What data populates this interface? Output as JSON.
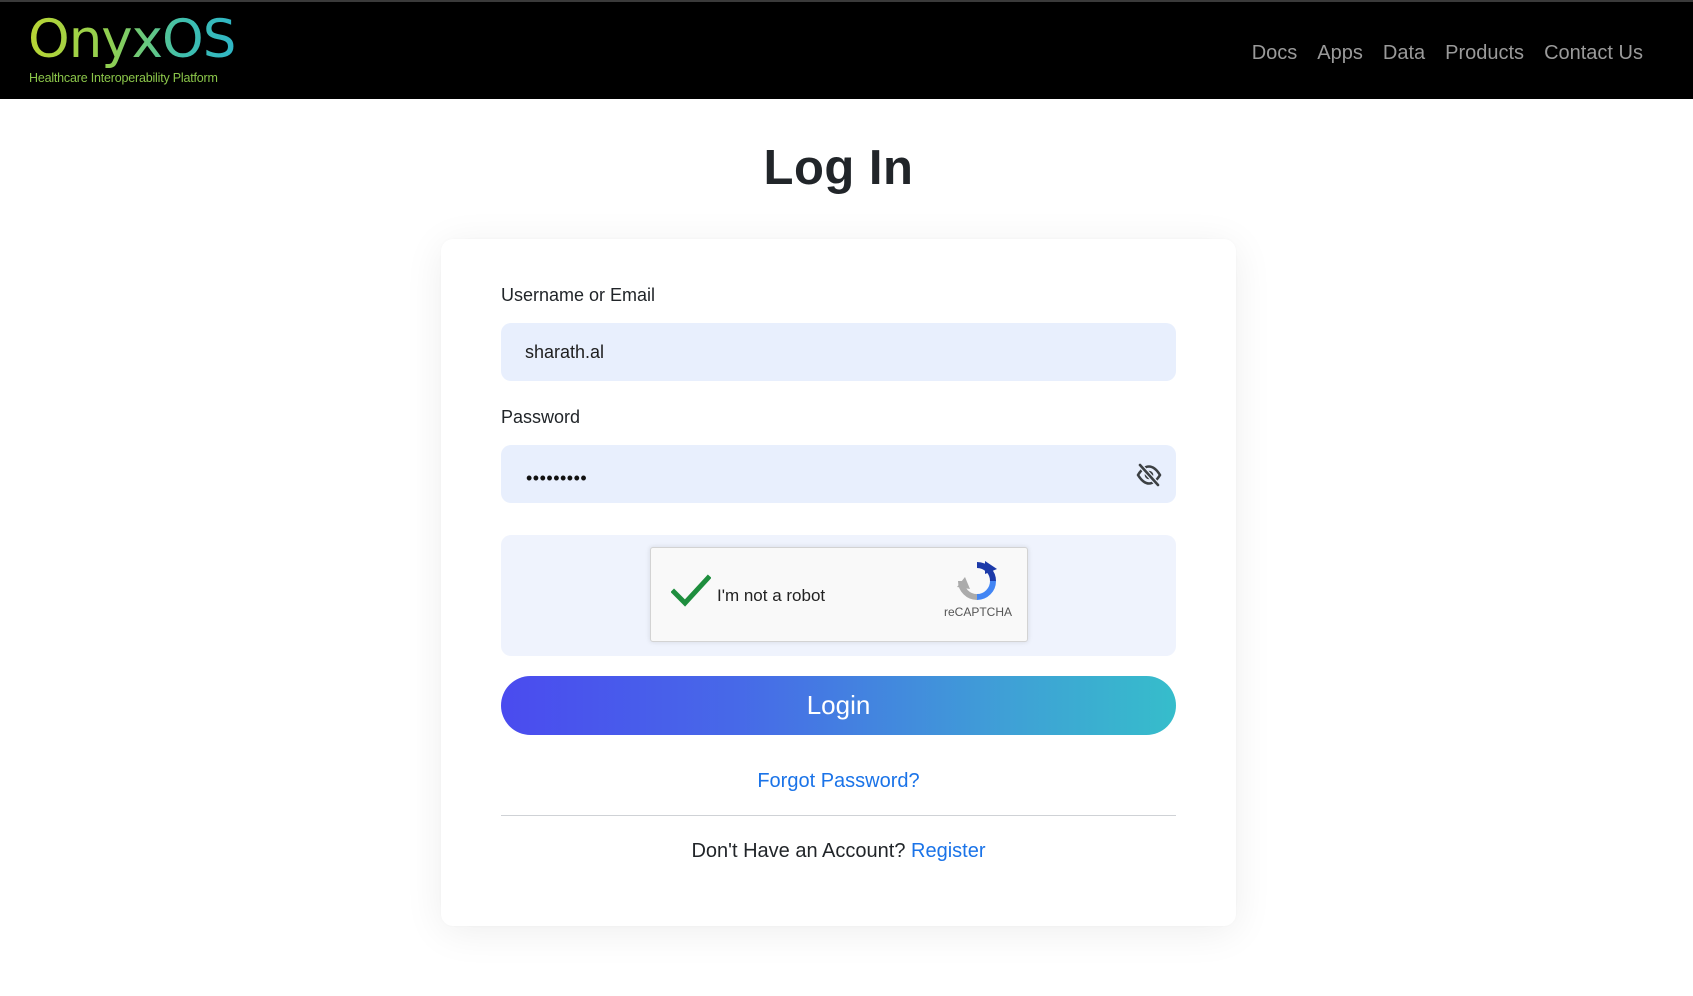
{
  "brand": {
    "name": "OnyxOS",
    "tagline": "Healthcare Interoperability Platform"
  },
  "nav": {
    "items": [
      "Docs",
      "Apps",
      "Data",
      "Products",
      "Contact Us"
    ]
  },
  "page": {
    "title": "Log In"
  },
  "form": {
    "username_label": "Username or Email",
    "username_value": "sharath.al",
    "password_label": "Password",
    "password_masked": "•••••••••",
    "visibility_icon": "eye-slash-icon"
  },
  "captcha": {
    "label": "I'm not a robot",
    "brand": "reCAPTCHA",
    "checked": true,
    "check_color": "#1e8e3e"
  },
  "actions": {
    "login_label": "Login",
    "forgot_label": "Forgot Password?",
    "no_account_text": "Don't Have an Account?",
    "register_label": "Register"
  },
  "colors": {
    "navbar_bg": "#000000",
    "input_bg": "#e8effd",
    "link": "#1a73e8",
    "button_gradient_start": "#4a4bef",
    "button_gradient_end": "#36bdcb"
  }
}
